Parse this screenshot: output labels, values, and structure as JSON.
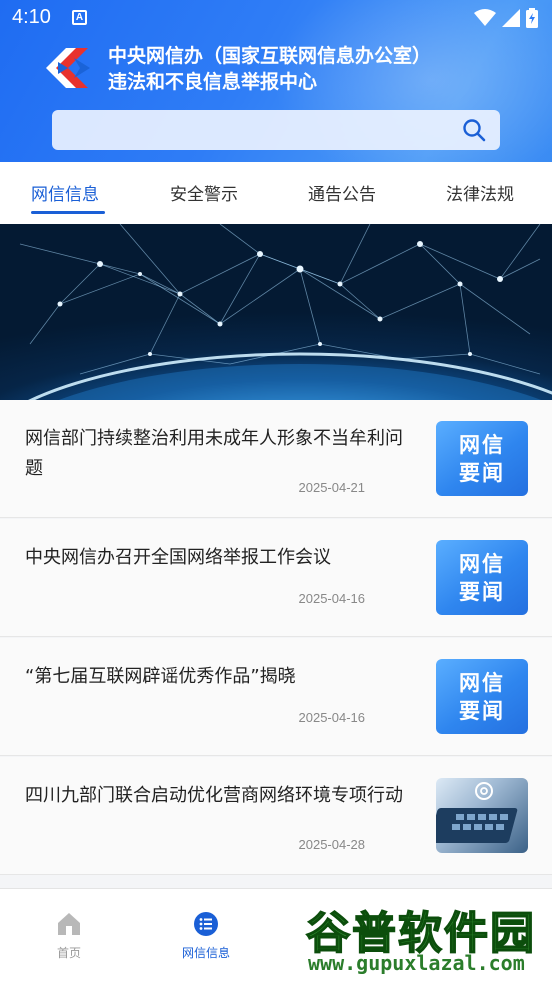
{
  "status_bar": {
    "time": "4:10",
    "notification_icon": "A"
  },
  "header": {
    "title_line1": "中央网信办（国家互联网信息办公室）",
    "title_line2": "违法和不良信息举报中心",
    "search_placeholder": "",
    "search_value": ""
  },
  "tabs": [
    {
      "label": "网信信息",
      "active": true
    },
    {
      "label": "安全警示",
      "active": false
    },
    {
      "label": "通告公告",
      "active": false
    },
    {
      "label": "法律法规",
      "active": false
    }
  ],
  "news": [
    {
      "title": "网信部门持续整治利用未成年人形象不当牟利问题",
      "date": "2025-04-21",
      "badge_line1": "网信",
      "badge_line2": "要闻"
    },
    {
      "title": "中央网信办召开全国网络举报工作会议",
      "date": "2025-04-16",
      "badge_line1": "网信",
      "badge_line2": "要闻"
    },
    {
      "title": "“第七届互联网辟谣优秀作品”揭晓",
      "date": "2025-04-16",
      "badge_line1": "网信",
      "badge_line2": "要闻"
    },
    {
      "title": "四川九部门联合启动优化营商网络环境专项行动",
      "date": "2025-04-28",
      "badge_line1": "",
      "badge_line2": ""
    }
  ],
  "bottom_nav": [
    {
      "label": "首页",
      "icon": "home-icon",
      "active": false
    },
    {
      "label": "网信信息",
      "icon": "list-icon",
      "active": true
    }
  ],
  "watermark": {
    "line1": "谷普软件园",
    "line2": "www.gupuxlazal.com"
  },
  "colors": {
    "accent": "#1a5fd6",
    "header_start": "#1f6cf2",
    "header_end": "#4c9bf7"
  }
}
